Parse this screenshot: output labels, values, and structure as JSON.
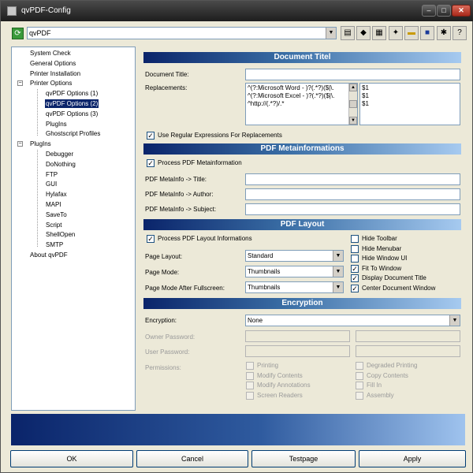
{
  "window": {
    "title": "qvPDF-Config",
    "min": "–",
    "max": "□",
    "close": "✕"
  },
  "toolbar": {
    "profile": "qvPDF",
    "icons": [
      "refresh-icon",
      "document-icon",
      "save-profile-icon",
      "printer-icon",
      "wand-icon",
      "folder-icon",
      "disk-icon",
      "settings-icon"
    ]
  },
  "tree": {
    "items": [
      "System Check",
      "General Options",
      "Printer Installation",
      "Printer Options",
      "qvPDF Options (1)",
      "qvPDF Options (2)",
      "qvPDF Options (3)",
      "PlugIns",
      "Ghostscript Profiles",
      "PlugIns",
      "Debugger",
      "DoNothing",
      "FTP",
      "GUI",
      "Hylafax",
      "MAPI",
      "SaveTo",
      "Script",
      "ShellOpen",
      "SMTP",
      "About qvPDF"
    ],
    "selected_index": 5
  },
  "document_title": {
    "header": "Document Titel",
    "title_label": "Document Title:",
    "title_value": "",
    "replacements_label": "Replacements:",
    "patterns": [
      "^(?:Microsoft Word - )?(.*?)($|\\.",
      "^(?:Microsoft Excel - )?(.*?)($|\\.",
      "^http://(.*?)/.*"
    ],
    "replacements": [
      "$1",
      "$1",
      "$1"
    ],
    "use_regex_label": "Use Regular Expressions For Replacements",
    "use_regex": true
  },
  "metainfo": {
    "header": "PDF Metainformations",
    "process_label": "Process PDF Metainformation",
    "process": true,
    "title_label": "PDF MetaInfo -> Title:",
    "author_label": "PDF MetaInfo ->  Author:",
    "subject_label": "PDF MetaInfo -> Subject:"
  },
  "layout": {
    "header": "PDF Layout",
    "process_label": "Process PDF Layout Informations",
    "process": true,
    "page_layout_label": "Page Layout:",
    "page_layout": "Standard",
    "page_mode_label": "Page Mode:",
    "page_mode": "Thumbnails",
    "fullscreen_label": "Page Mode After Fullscreen:",
    "fullscreen_mode": "Thumbnails",
    "options": [
      {
        "label": "Hide Toolbar",
        "checked": false
      },
      {
        "label": "Hide Menubar",
        "checked": false
      },
      {
        "label": "Hide Window UI",
        "checked": false
      },
      {
        "label": "Fit To Window",
        "checked": true
      },
      {
        "label": "Display Document Title",
        "checked": true
      },
      {
        "label": "Center Document Window",
        "checked": true
      }
    ]
  },
  "encryption": {
    "header": "Encryption",
    "encryption_label": "Encryption:",
    "encryption_value": "None",
    "owner_label": "Owner Password:",
    "user_label": "User Password:",
    "permissions_label": "Permissions:",
    "permissions_left": [
      "Printing",
      "Modify Contents",
      "Modify Annotations",
      "Screen Readers"
    ],
    "permissions_right": [
      "Degraded Printing",
      "Copy Contents",
      "Fill In",
      "Assembly"
    ]
  },
  "buttons": {
    "ok": "OK",
    "cancel": "Cancel",
    "testpage": "Testpage",
    "apply": "Apply"
  }
}
